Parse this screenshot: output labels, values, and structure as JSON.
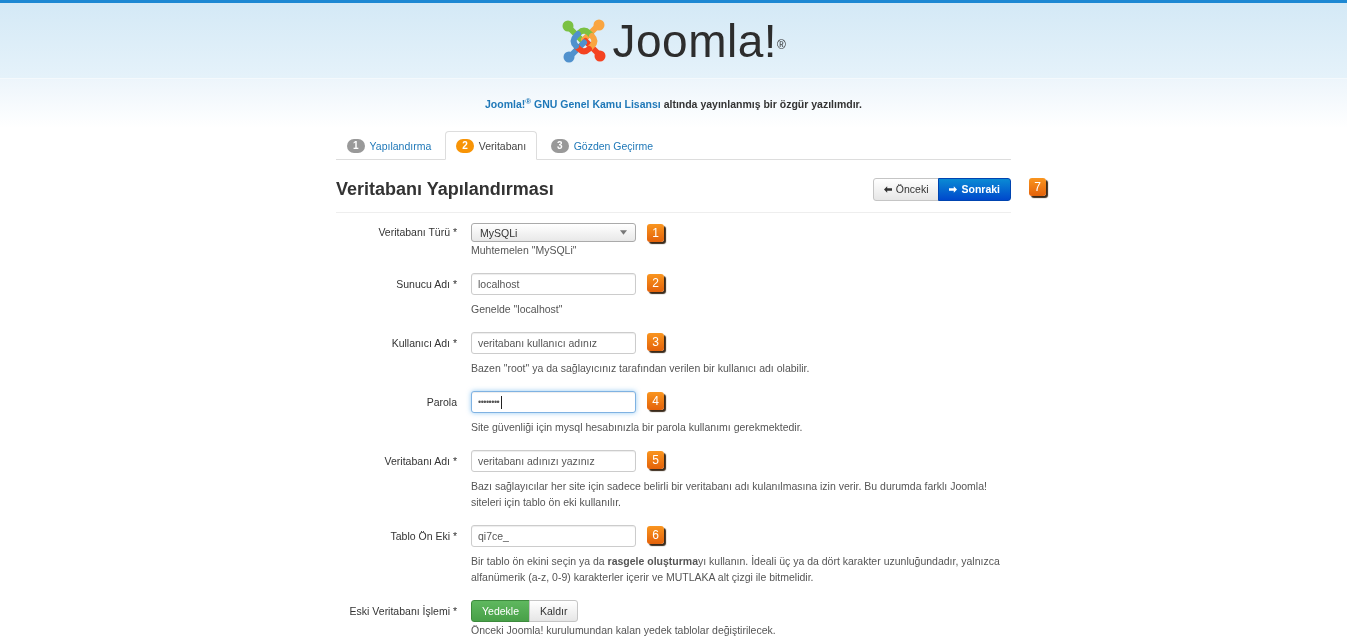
{
  "header": {
    "logo": "Joomla!$^{®}$"
  },
  "license": [
    {
      "kind": "link",
      "text": "Joomla!$^{®}$"
    },
    {
      "kind": "link",
      "text": "GNU Genel Kamu Lisansı"
    },
    {
      "kind": "text",
      "text": "altında yayınlanmış bir özgür yazılımdır."
    }
  ],
  "tabs": [
    {
      "number": "1",
      "label": "Yapılandırma",
      "selected": false
    },
    {
      "number": "2",
      "label": "Veritabanı",
      "selected": true
    },
    {
      "number": "3",
      "label": "Gözden Geçirme",
      "selected": false
    }
  ],
  "page_title": "Veritabanı Yapılandırması",
  "nav_buttons": [
    {
      "kind": "previous",
      "label": "Önceki",
      "primary": false
    },
    {
      "kind": "next",
      "label": "Sonraki",
      "primary": true
    }
  ],
  "nav_marker": "7",
  "fields": [
    {
      "kind": "select",
      "label": "Veritabanı Türü *",
      "value": "MySQLi",
      "focused": false,
      "help": "Muhtemelen \"MySQLi\"",
      "marker": "1"
    },
    {
      "kind": "text",
      "label": "Sunucu Adı *",
      "value": "localhost",
      "focused": false,
      "help": "Genelde \"localhost\"",
      "marker": "2"
    },
    {
      "kind": "text",
      "label": "Kullanıcı Adı *",
      "value": "veritabanı kullanıcı adınız",
      "focused": false,
      "help": "Bazen \"root\" ya da sağlayıcınız tarafından verilen bir kullanıcı adı olabilir.",
      "marker": "3"
    },
    {
      "kind": "password",
      "label": "Parola",
      "value": "••••••••",
      "focused": true,
      "help": "Site güvenliği için mysql hesabınızla bir parola kullanımı gerekmektedir.",
      "marker": "4"
    },
    {
      "kind": "text",
      "label": "Veritabanı Adı *",
      "value": "veritabanı adınızı yazınız",
      "focused": false,
      "help": "Bazı sağlayıcılar her site için sadece belirli bir veritabanı adı kulanılmasına izin verir. Bu durumda farklı Joomla! siteleri için tablo ön eki kullanılır.",
      "marker": "5"
    },
    {
      "kind": "text",
      "label": "Tablo Ön Eki *",
      "value": "qi7ce_",
      "focused": false,
      "help": "Bir tablo ön ekini seçin ya da **rasgele oluşturma**yı kullanın. İdeali üç ya da dört karakter uzunluğundadır, yalnızca alfanümerik (a-z, 0-9) karakterler içerir ve MUTLAKA alt çizgi ile bitmelidir.",
      "marker": "6"
    },
    {
      "kind": "toggle",
      "label": "Eski Veritabanı İşlemi *",
      "options": [
        {
          "label": "Yedekle",
          "selected": true
        },
        {
          "label": "Kaldır",
          "selected": false
        }
      ],
      "help": "Önceki Joomla! kurulumundan kalan yedek tablolar değiştirilecek."
    }
  ]
}
